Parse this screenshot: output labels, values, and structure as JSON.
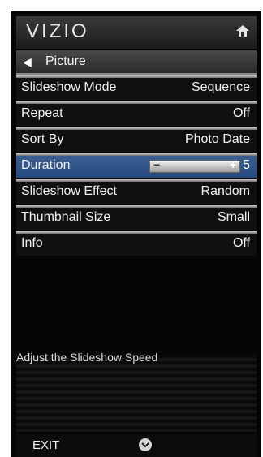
{
  "header": {
    "logo": "VIZIO",
    "home_icon": "home-icon"
  },
  "nav": {
    "back_label": "Picture",
    "back_icon": "left-arrow-icon"
  },
  "menu": {
    "items": [
      {
        "label": "Slideshow Mode",
        "value": "Sequence"
      },
      {
        "label": "Repeat",
        "value": "Off"
      },
      {
        "label": "Sort By",
        "value": "Photo Date"
      },
      {
        "label": "Duration",
        "value": "5",
        "slider_minus": "−",
        "slider_plus": "+"
      },
      {
        "label": "Slideshow Effect",
        "value": "Random"
      },
      {
        "label": "Thumbnail Size",
        "value": "Small"
      },
      {
        "label": "Info",
        "value": "Off"
      }
    ]
  },
  "description": "Adjust the Slideshow Speed",
  "footer": {
    "exit_label": "EXIT",
    "nav_icon": "down-chevron-icon"
  },
  "colors": {
    "selected_row": "#2f5488",
    "background": "#050505"
  }
}
